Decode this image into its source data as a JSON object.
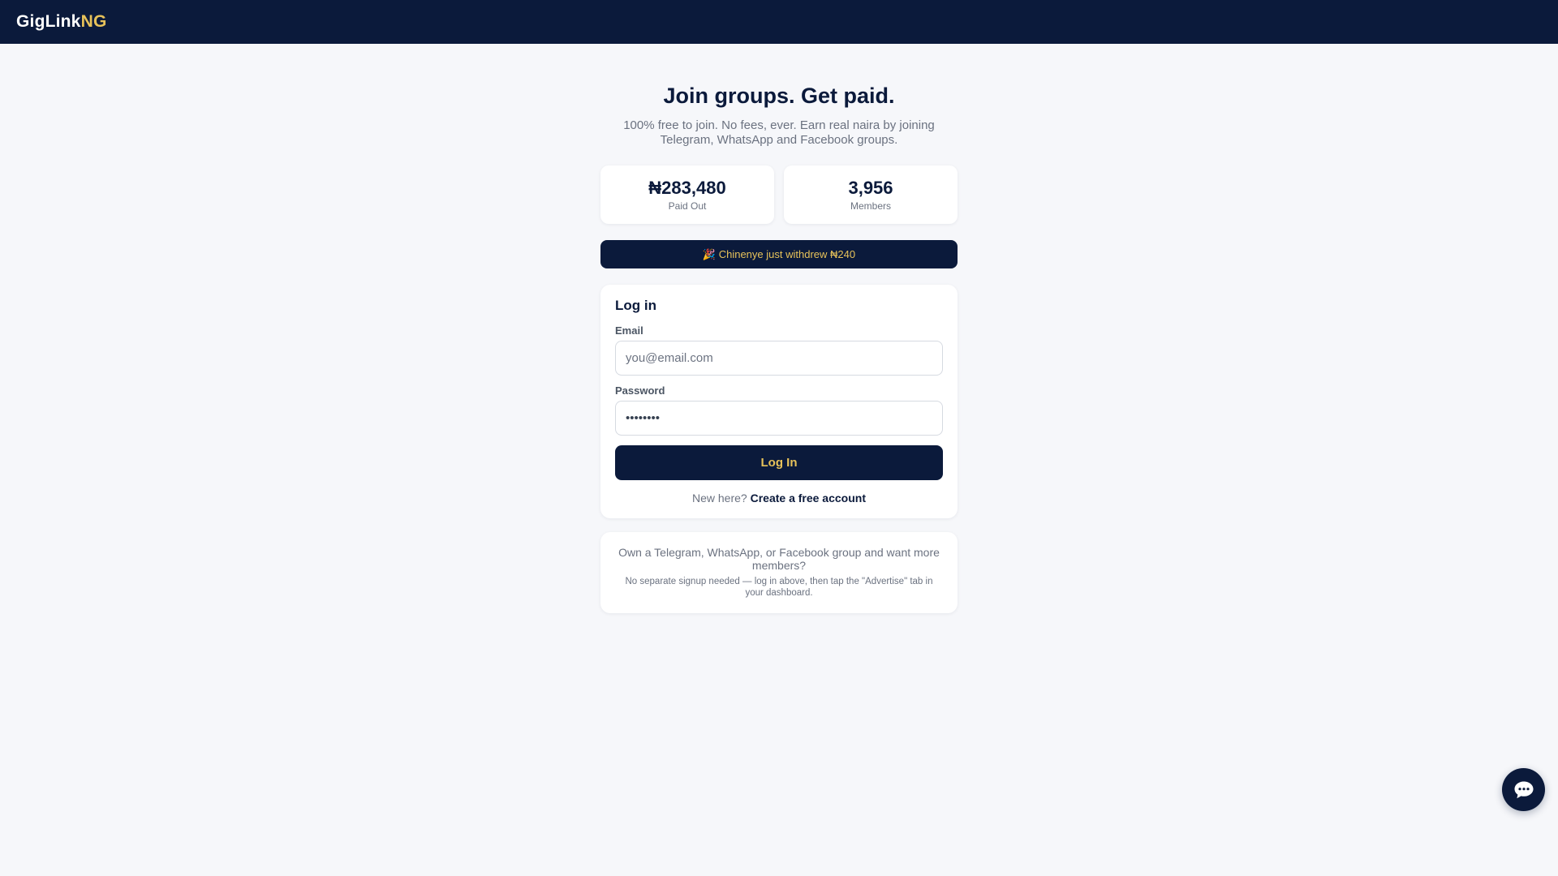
{
  "nav": {
    "brand_main": "GigLink",
    "brand_accent": "NG"
  },
  "hero": {
    "title": "Join groups. Get paid.",
    "subtitle": "100% free to join. No fees, ever. Earn real naira by joining Telegram, WhatsApp and Facebook groups."
  },
  "stats": [
    {
      "value": "₦283,480",
      "label": "Paid Out"
    },
    {
      "value": "3,956",
      "label": "Members"
    }
  ],
  "ticker": {
    "emoji": "🎉",
    "text": "Chinenye just withdrew ₦240"
  },
  "login": {
    "title": "Log in",
    "email_label": "Email",
    "email_placeholder": "you@email.com",
    "password_label": "Password",
    "password_value": "password",
    "submit_label": "Log In",
    "signup_prompt": "New here?",
    "signup_link": "Create a free account"
  },
  "advertise": {
    "main": "Own a Telegram, WhatsApp, or Facebook group and want more members?",
    "note": "No separate signup needed — log in above, then tap the \"Advertise\" tab in your dashboard."
  },
  "chat": {
    "icon": "chat-bubble-icon"
  },
  "colors": {
    "navy": "#0b1a3b",
    "gold": "#e7c25a",
    "page_bg": "#f6f7fa"
  }
}
